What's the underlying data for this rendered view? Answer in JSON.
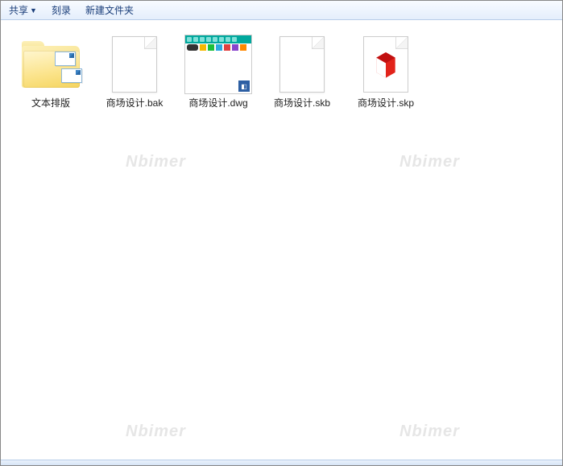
{
  "toolbar": {
    "share": "共享",
    "burn": "刻录",
    "new_folder": "新建文件夹"
  },
  "items": [
    {
      "name": "文本排版",
      "kind": "folder"
    },
    {
      "name": "商场设计.bak",
      "kind": "blank"
    },
    {
      "name": "商场设计.dwg",
      "kind": "dwg"
    },
    {
      "name": "商场设计.skb",
      "kind": "blank"
    },
    {
      "name": "商场设计.skp",
      "kind": "skp"
    }
  ],
  "watermark": "Nbimer"
}
